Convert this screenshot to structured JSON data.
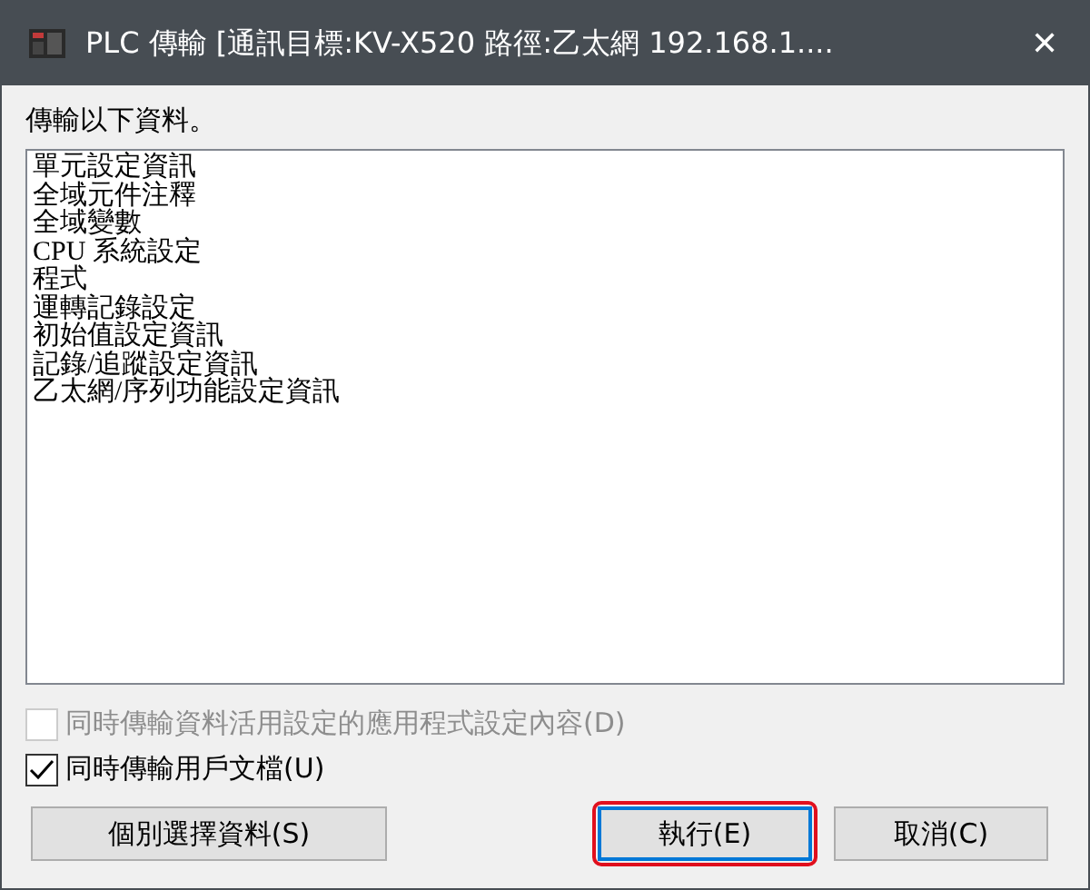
{
  "window": {
    "title": "PLC 傳輸 [通訊目標:KV-X520 路徑:乙太網  192.168.1....",
    "close": "✕"
  },
  "prompt": "傳輸以下資料。",
  "list_items": [
    "單元設定資訊",
    "全域元件注釋",
    "全域變數",
    "CPU 系統設定",
    "程式",
    "運轉記錄設定",
    "初始值設定資訊",
    "記錄/追蹤設定資訊",
    "乙太網/序列功能設定資訊"
  ],
  "options": [
    {
      "label": "同時傳輸資料活用設定的應用程式設定內容(D)",
      "checked": false,
      "disabled": true
    },
    {
      "label": "同時傳輸用戶文檔(U)",
      "checked": true,
      "disabled": false
    }
  ],
  "buttons": [
    {
      "label": "個別選擇資料(S)",
      "highlighted": false,
      "default": false
    },
    {
      "label": "執行(E)",
      "highlighted": true,
      "default": true
    },
    {
      "label": "取消(C)",
      "highlighted": false,
      "default": false
    }
  ]
}
